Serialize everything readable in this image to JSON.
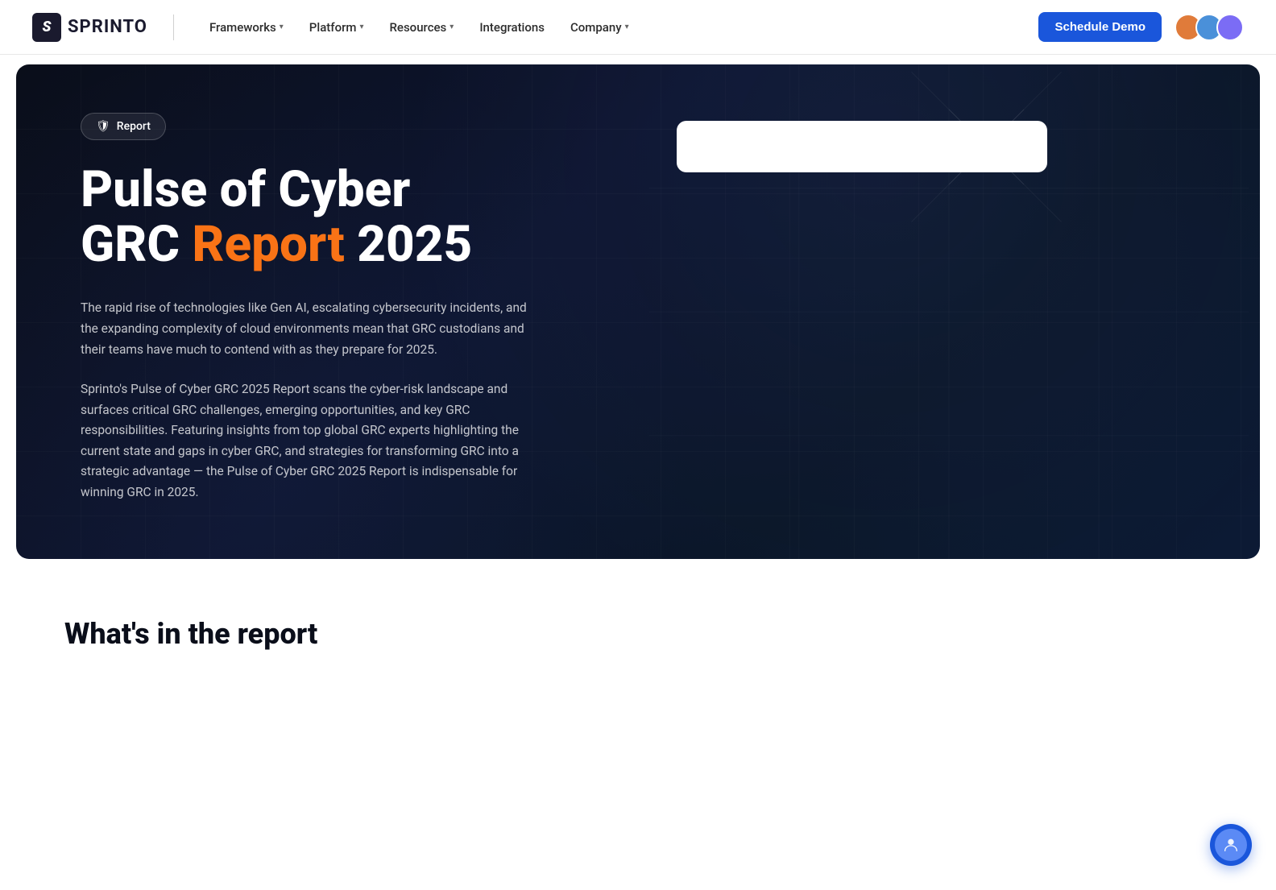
{
  "brand": {
    "logo_letter": "S",
    "logo_name": "SPRINTO"
  },
  "navbar": {
    "items": [
      {
        "label": "Frameworks",
        "has_dropdown": true
      },
      {
        "label": "Platform",
        "has_dropdown": true
      },
      {
        "label": "Resources",
        "has_dropdown": true
      },
      {
        "label": "Integrations",
        "has_dropdown": false
      },
      {
        "label": "Company",
        "has_dropdown": true
      }
    ],
    "cta_label": "Schedule Demo",
    "avatars": [
      {
        "color": "#e07b3a",
        "initials": ""
      },
      {
        "color": "#4a90d9",
        "initials": ""
      },
      {
        "color": "#7b6cf5",
        "initials": ""
      }
    ]
  },
  "hero": {
    "badge_label": "Report",
    "title_line1": "Pulse of Cyber",
    "title_line2_part1": "GRC ",
    "title_line2_orange": "Report",
    "title_line2_part2": " 2025",
    "description_1": "The rapid rise of technologies like Gen AI, escalating cybersecurity incidents, and the expanding complexity of cloud environments mean that GRC custodians and their teams have much to contend with as they prepare for 2025.",
    "description_2": "Sprinto's Pulse of Cyber GRC 2025 Report scans the cyber-risk landscape and surfaces critical GRC challenges, emerging opportunities, and key GRC responsibilities. Featuring insights from top global GRC experts highlighting the current state and gaps in cyber GRC, and strategies for transforming GRC into a strategic advantage — the Pulse of Cyber GRC 2025 Report is indispensable for winning GRC in 2025."
  },
  "below_hero": {
    "section_title": "What's in the report"
  },
  "icons": {
    "shield": "🛡",
    "chevron_down": "▾",
    "chat": "💬"
  }
}
